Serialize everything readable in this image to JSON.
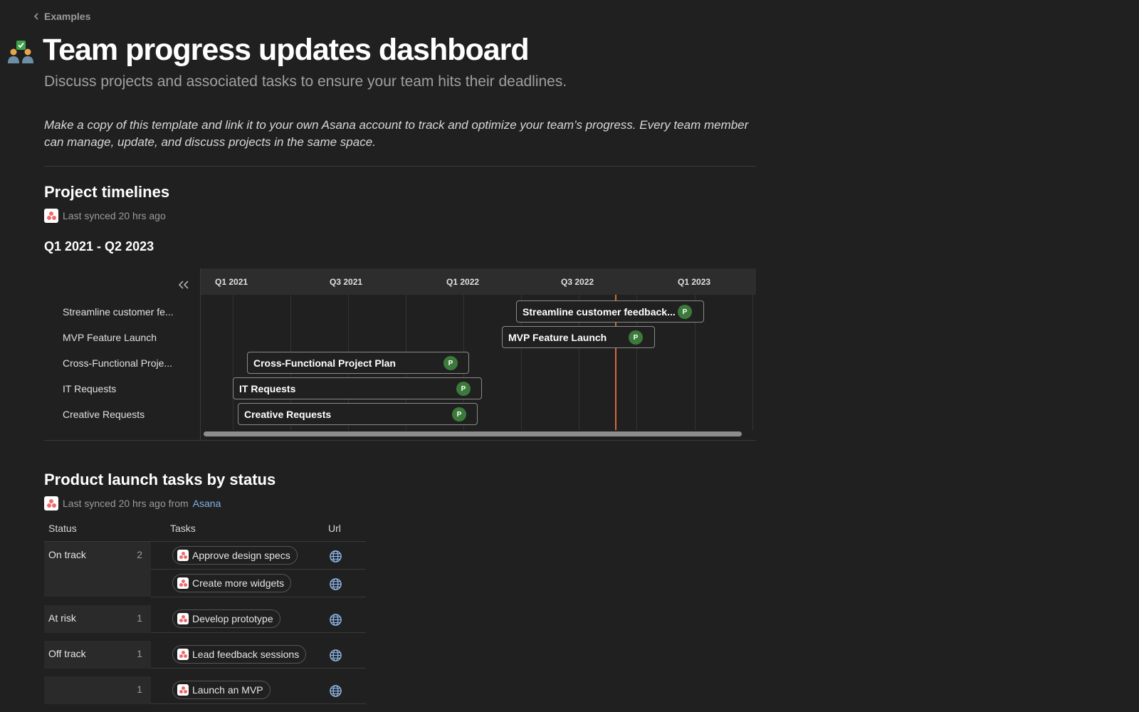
{
  "nav": {
    "back_label": "Examples"
  },
  "header": {
    "title": "Team progress updates dashboard",
    "subtitle": "Discuss projects and associated tasks to ensure your team hits their deadlines.",
    "description": "Make a copy of this template and link it to your own Asana account to track and optimize your team’s progress. Every team member can manage, update, and discuss projects in the same space."
  },
  "timeline_section": {
    "title": "Project timelines",
    "sync_text": "Last synced 20 hrs ago",
    "range_title": "Q1 2021 - Q2 2023",
    "quarters": [
      "Q1 2021",
      "Q3 2021",
      "Q1 2022",
      "Q3 2022",
      "Q1 2023"
    ],
    "rows": [
      {
        "label": "Streamline customer fe...",
        "bar_label": "Streamline customer feedback...",
        "avatar": "P"
      },
      {
        "label": "MVP Feature Launch",
        "bar_label": "MVP Feature Launch",
        "avatar": "P"
      },
      {
        "label": "Cross-Functional Proje...",
        "bar_label": "Cross-Functional Project Plan",
        "avatar": "P"
      },
      {
        "label": "IT Requests",
        "bar_label": "IT Requests",
        "avatar": "P"
      },
      {
        "label": "Creative Requests",
        "bar_label": "Creative Requests",
        "avatar": "P"
      }
    ]
  },
  "tasks_section": {
    "title": "Product launch tasks by status",
    "sync_prefix": "Last synced 20 hrs ago from",
    "sync_link": "Asana",
    "columns": {
      "status": "Status",
      "tasks": "Tasks",
      "url": "Url"
    },
    "groups": [
      {
        "status": "On track",
        "count": "2",
        "tasks": [
          "Approve design specs",
          "Create more widgets"
        ]
      },
      {
        "status": "At risk",
        "count": "1",
        "tasks": [
          "Develop prototype"
        ]
      },
      {
        "status": "Off track",
        "count": "1",
        "tasks": [
          "Lead feedback sessions"
        ]
      },
      {
        "status": "",
        "count": "1",
        "tasks": [
          "Launch an MVP"
        ]
      }
    ]
  },
  "colors": {
    "background": "#202020",
    "today_line": "#d46a3a",
    "avatar": "#3b7a3b",
    "link": "#7fb2e6",
    "asana_brand": "#f06a6a"
  }
}
